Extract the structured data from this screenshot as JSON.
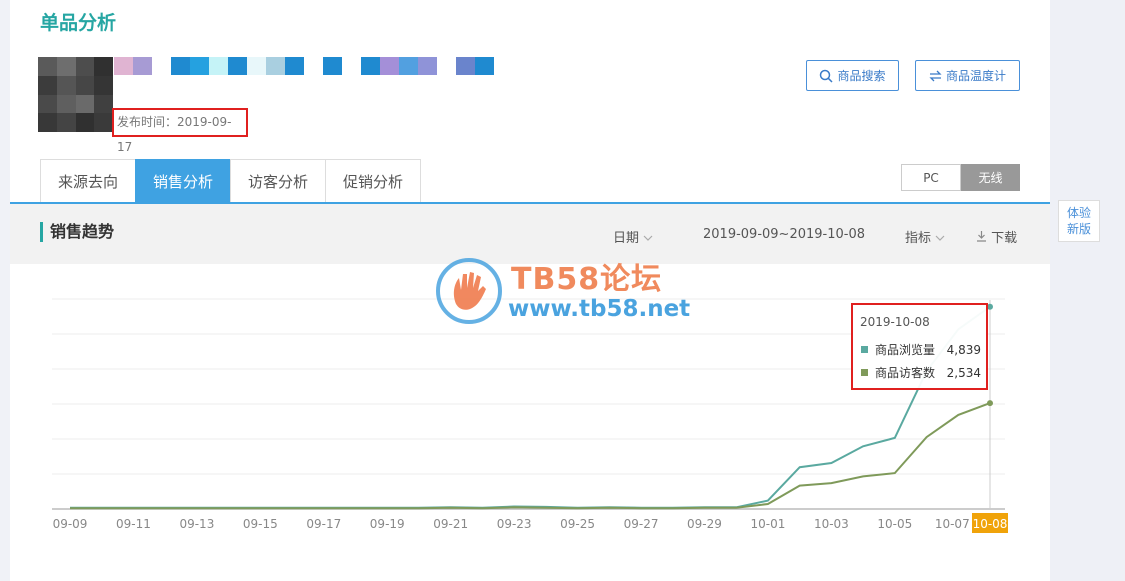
{
  "page": {
    "title": "单品分析"
  },
  "product": {
    "publish_time": "发布时间：2019-09-17",
    "thumb_colors": [
      "#5a5a5a",
      "#6e6e6e",
      "#4d4d4d",
      "#303030",
      "#3c3c3c",
      "#555555",
      "#464646",
      "#353535",
      "#4a4a4a",
      "#5f5f5f",
      "#6a6a6a",
      "#404040",
      "#383838",
      "#444444",
      "#303030",
      "#3a3a3a"
    ],
    "title_pixels": [
      "#e0b4d2",
      "#a79bd4",
      "#ffffff",
      "#1f8ad0",
      "#25a1e0",
      "#c5f3f7",
      "#1f8ad0",
      "#e8f7fa",
      "#a9cfe0",
      "#1f8ad0",
      "#ffffff",
      "#1f8ad0",
      "#ffffff",
      "#1f8ad0",
      "#a48fd8",
      "#52a0e0",
      "#8f93d8",
      "#ffffff",
      "#6a84cc",
      "#1f8ad0"
    ]
  },
  "actions": {
    "search": {
      "label": "商品搜索",
      "icon": "search-icon"
    },
    "thermometer": {
      "label": "商品温度计",
      "icon": "swap-icon"
    }
  },
  "tabs": [
    {
      "label": "来源去向",
      "active": false
    },
    {
      "label": "销售分析",
      "active": true
    },
    {
      "label": "访客分析",
      "active": false
    },
    {
      "label": "促销分析",
      "active": false
    }
  ],
  "device_toggle": {
    "pc": "PC",
    "wireless": "无线",
    "selected": "无线"
  },
  "section": {
    "title": "销售趋势",
    "date_label": "日期",
    "date_range": "2019-09-09~2019-10-08",
    "metric_label": "指标",
    "download_label": "下载"
  },
  "side_panel": {
    "line1": "体验",
    "line2": "新版"
  },
  "watermark": {
    "title": "TB58论坛",
    "url": "www.tb58.net"
  },
  "tooltip": {
    "date": "2019-10-08",
    "rows": [
      {
        "name": "商品浏览量",
        "value": "4,839",
        "color": "#5aa9a0"
      },
      {
        "name": "商品访客数",
        "value": "2,534",
        "color": "#7f9a5a"
      }
    ]
  },
  "chart_data": {
    "type": "line",
    "x": [
      "09-09",
      "09-10",
      "09-11",
      "09-12",
      "09-13",
      "09-14",
      "09-15",
      "09-16",
      "09-17",
      "09-18",
      "09-19",
      "09-20",
      "09-21",
      "09-22",
      "09-23",
      "09-24",
      "09-25",
      "09-26",
      "09-27",
      "09-28",
      "09-29",
      "09-30",
      "10-01",
      "10-02",
      "10-03",
      "10-04",
      "10-05",
      "10-06",
      "10-07",
      "10-08"
    ],
    "tick_labels": [
      "09-09",
      "09-11",
      "09-13",
      "09-15",
      "09-17",
      "09-19",
      "09-21",
      "09-23",
      "09-25",
      "09-27",
      "09-29",
      "10-01",
      "10-03",
      "10-05",
      "10-07",
      "10-08"
    ],
    "highlighted_tick": "10-08",
    "series": [
      {
        "name": "商品浏览量",
        "color": "#5aa9a0",
        "values": [
          30,
          30,
          30,
          30,
          30,
          30,
          30,
          30,
          30,
          30,
          30,
          30,
          40,
          30,
          60,
          50,
          30,
          40,
          30,
          30,
          40,
          40,
          200,
          1000,
          1100,
          1500,
          1700,
          3300,
          4300,
          4839
        ]
      },
      {
        "name": "商品访客数",
        "color": "#7f9a5a",
        "values": [
          20,
          20,
          20,
          20,
          20,
          20,
          20,
          20,
          20,
          20,
          20,
          20,
          30,
          20,
          40,
          30,
          20,
          30,
          20,
          20,
          30,
          30,
          120,
          560,
          620,
          780,
          860,
          1720,
          2250,
          2534
        ]
      }
    ],
    "grid": true,
    "legend": "tooltip"
  }
}
